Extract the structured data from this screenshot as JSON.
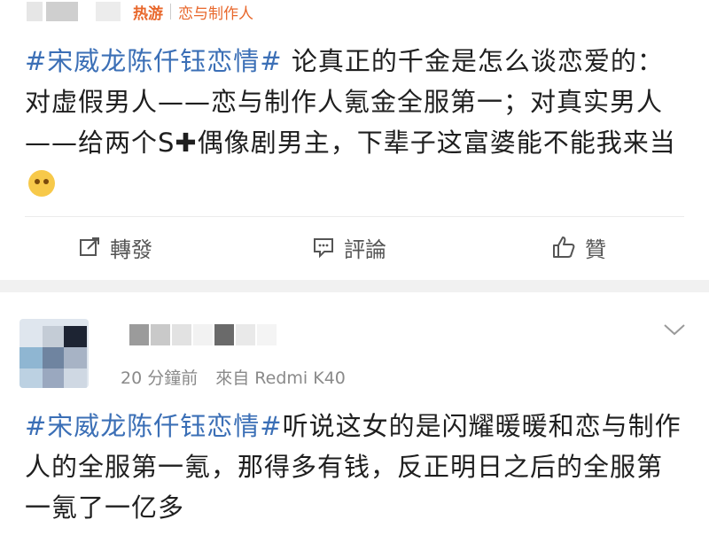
{
  "post1": {
    "source_hot": "热游",
    "source_name": "恋与制作人",
    "hashtag": "#宋威龙陈仟钰恋情#",
    "body": " 论真正的千金是怎么谈恋爱的：对虚假男人——恋与制作人氪金全服第一；对真实男人——给两个S",
    "plus": "✚",
    "body_tail": "偶像剧男主，下辈子这富婆能不能我来当",
    "emoji_icon": "crying-face-emoji",
    "actions": {
      "repost": "轉發",
      "comment": "評論",
      "like": "贊"
    }
  },
  "post2": {
    "time": "20 分鐘前",
    "source": "來自 Redmi K40",
    "hashtag": "#宋威龙陈仟钰恋情#",
    "body": "听说这女的是闪耀暖暖和恋与制作人的全服第一氪，那得多有钱，反正明日之后的全服第一氪了一亿多"
  },
  "colors": {
    "hashtag": "#3b6fb6",
    "source_accent": "#e8672b",
    "separator_band": "#f1f1f1"
  }
}
